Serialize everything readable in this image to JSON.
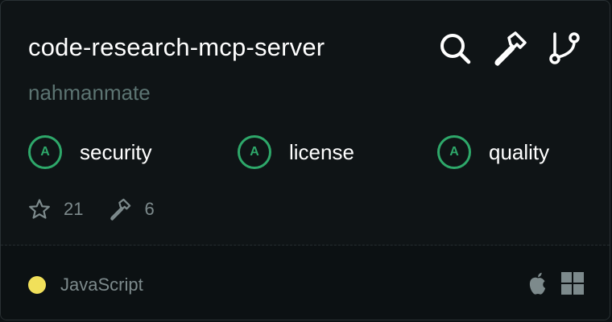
{
  "repo": {
    "name": "code-research-mcp-server",
    "author": "nahmanmate"
  },
  "actions": [
    {
      "icon": "search-icon"
    },
    {
      "icon": "hammer-icon"
    },
    {
      "icon": "git-branch-icon"
    }
  ],
  "grades": [
    {
      "grade": "A",
      "label": "security"
    },
    {
      "grade": "A",
      "label": "license"
    },
    {
      "grade": "A",
      "label": "quality"
    }
  ],
  "stats": {
    "stars": "21",
    "tools": "6"
  },
  "footer": {
    "language": "JavaScript",
    "language_color": "#f1e05a",
    "platforms": [
      "apple-icon",
      "windows-icon"
    ]
  },
  "colors": {
    "grade_green": "#2ea86a",
    "muted_text": "#7d8a8c",
    "author_text": "#5c7472"
  }
}
